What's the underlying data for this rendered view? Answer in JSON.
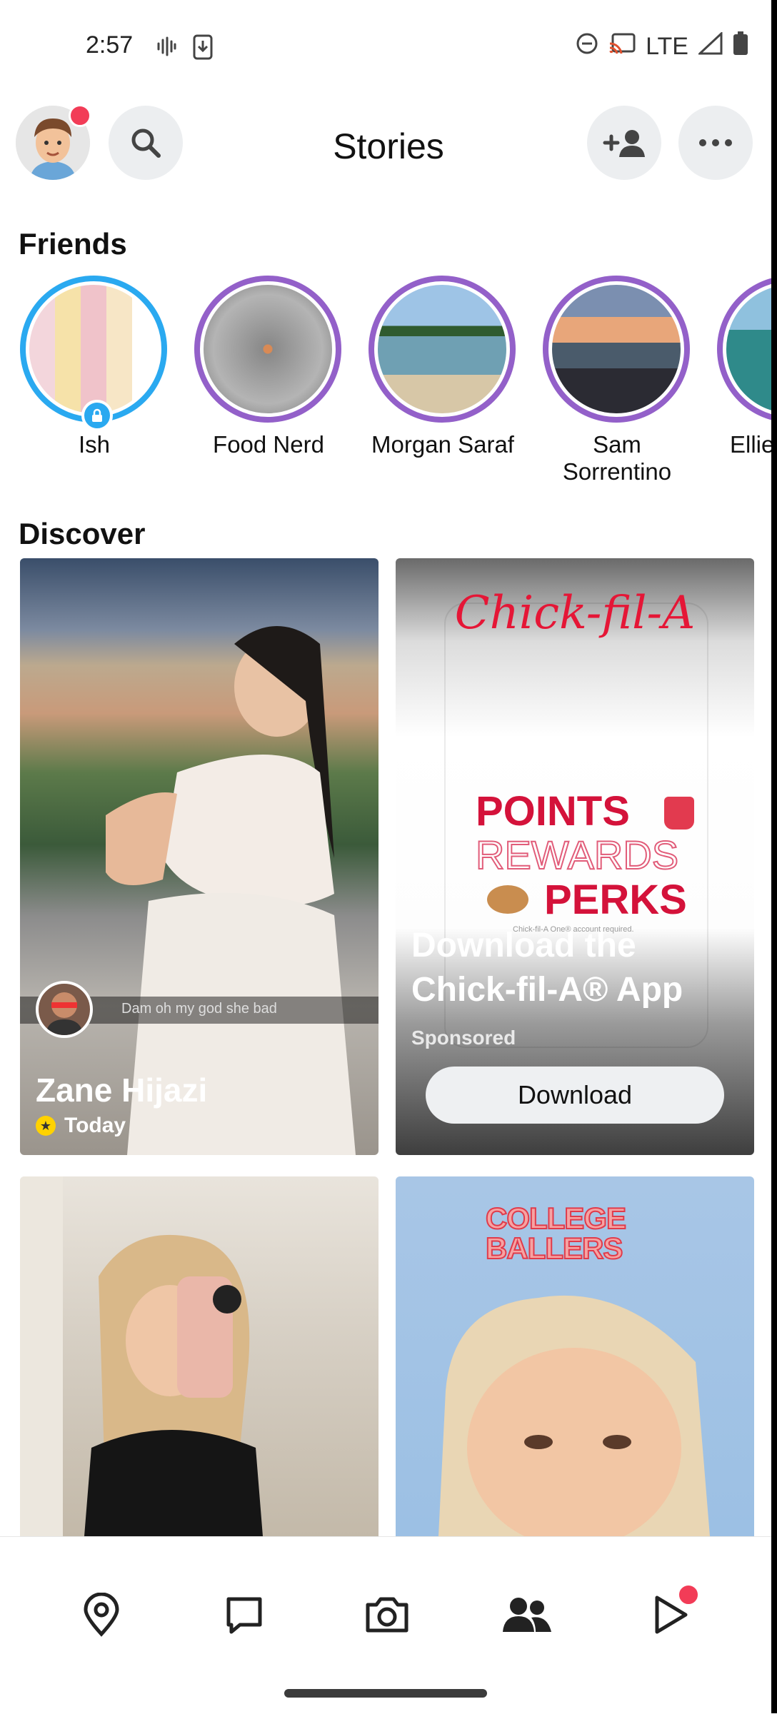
{
  "status_bar": {
    "time": "2:57",
    "network": "LTE"
  },
  "header": {
    "title": "Stories",
    "notification_color": "#f23c57"
  },
  "friends": {
    "section_title": "Friends",
    "items": [
      {
        "name": "Ish",
        "ring": "#2aa9f0",
        "locked": true
      },
      {
        "name": "Food Nerd",
        "ring": "#9360c9"
      },
      {
        "name": "Morgan Saraf",
        "ring": "#9360c9"
      },
      {
        "name": "Sam Sorrentino",
        "ring": "#9360c9"
      },
      {
        "name": "Ellie",
        "ring": "#9360c9"
      }
    ]
  },
  "discover": {
    "section_title": "Discover",
    "cards": [
      {
        "name": "Zane Hijazi",
        "time": "Today",
        "caption": "Dam oh my god she bad"
      },
      {
        "brand": "Chick-fil-A",
        "promo_lines": [
          "POINTS",
          "REWARDS",
          "PERKS"
        ],
        "fine_print": "Chick-fil-A One® account required.",
        "ad_title": "Download the Chick-fil-A® App",
        "sponsored": "Sponsored",
        "button": "Download"
      },
      {
        "name": ""
      },
      {
        "banner": "COLLEGE BALLERS"
      }
    ]
  },
  "bottom_nav": {
    "items": [
      "map",
      "chat",
      "camera",
      "stories",
      "spotlight"
    ],
    "active": "stories"
  }
}
